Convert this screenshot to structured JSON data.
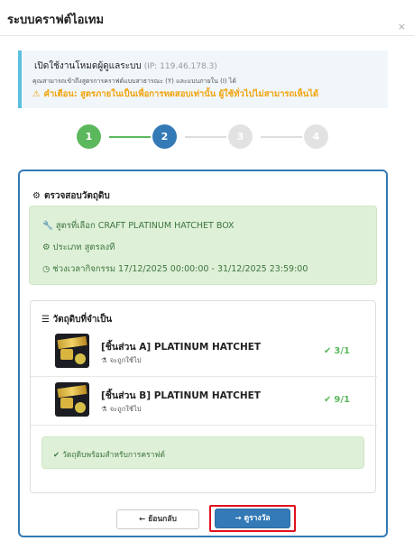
{
  "window": {
    "title": "ระบบคราฟต์ไอเทม",
    "close_glyph": "×"
  },
  "info": {
    "heading": "เปิดใช้งานโหมดผู้ดูแลระบบ",
    "ip": "(IP: 119.46.178.3)",
    "description": "คุณสามารถเข้าถึงสูตรการคราฟต์แบบสาธารณะ (Y) และแบบภายใน (I) ได้",
    "warning": "คำเตือน: สูตรภายในเป็นเพื่อการทดสอบเท่านั้น ผู้ใช้ทั่วไปไม่สามารถเห็นได้",
    "warning_glyph": "⚠"
  },
  "steps": [
    "1",
    "2",
    "3",
    "4"
  ],
  "steps_state": {
    "completed": 1,
    "current": 2
  },
  "panel": {
    "title": "ตรวจสอบวัตถุดิบ",
    "title_icon": "gears-icon",
    "recipe": {
      "selected_label": "สูตรที่เลือก",
      "selected_value": "CRAFT PLATINUM HATCHET BOX",
      "type_label": "ประเภท",
      "type_value": "สูตรลงที",
      "period_label": "ช่วงเวลากิจกรรม",
      "period_value": "17/12/2025 00:00:00 - 31/12/2025 23:59:00"
    },
    "requirements": {
      "title": "วัตถุดิบที่จำเป็น",
      "items": [
        {
          "name": "[ชิ้นส่วน A] PLATINUM HATCHET",
          "note": "จะถูกใช้ไป",
          "count": "3/1"
        },
        {
          "name": "[ชิ้นส่วน B] PLATINUM HATCHET",
          "note": "จะถูกใช้ไป",
          "count": "9/1"
        }
      ],
      "ready": "วัตถุดิบพร้อมสำหรับการคราฟต์"
    }
  },
  "buttons": {
    "back": "ย้อนกลับ",
    "next": "ดูรางวัล"
  },
  "colors": {
    "primary": "#337ab7",
    "success": "#5cb85c",
    "warning": "#f0a30a",
    "highlight": "#e0101e"
  }
}
